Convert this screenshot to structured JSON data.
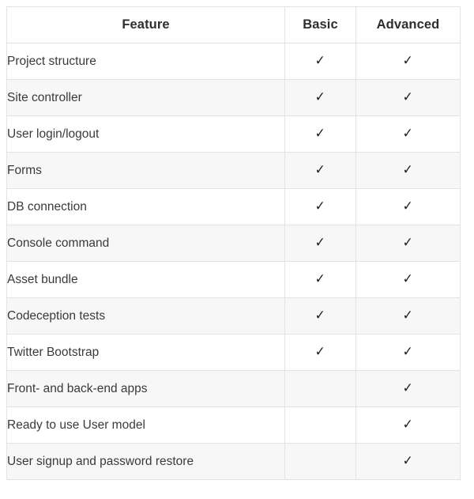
{
  "table": {
    "columns": [
      {
        "key": "feature",
        "label": "Feature",
        "align": "left"
      },
      {
        "key": "basic",
        "label": "Basic",
        "align": "center"
      },
      {
        "key": "advanced",
        "label": "Advanced",
        "align": "center"
      }
    ],
    "check_mark": "✓",
    "colors": {
      "row_odd_background": "#ffffff",
      "row_even_background": "#f7f7f7",
      "border": "#e3e3e3",
      "header_text": "#2e2e2e",
      "body_text": "#3a3a3a",
      "check_mark_color": "#1b1b1b"
    },
    "rows": [
      {
        "feature": "Project structure",
        "basic": "✓",
        "advanced": "✓"
      },
      {
        "feature": "Site controller",
        "basic": "✓",
        "advanced": "✓"
      },
      {
        "feature": "User login/logout",
        "basic": "✓",
        "advanced": "✓"
      },
      {
        "feature": "Forms",
        "basic": "✓",
        "advanced": "✓"
      },
      {
        "feature": "DB connection",
        "basic": "✓",
        "advanced": "✓"
      },
      {
        "feature": "Console command",
        "basic": "✓",
        "advanced": "✓"
      },
      {
        "feature": "Asset bundle",
        "basic": "✓",
        "advanced": "✓"
      },
      {
        "feature": "Codeception tests",
        "basic": "✓",
        "advanced": "✓"
      },
      {
        "feature": "Twitter Bootstrap",
        "basic": "✓",
        "advanced": "✓"
      },
      {
        "feature": "Front- and back-end apps",
        "basic": "",
        "advanced": "✓"
      },
      {
        "feature": "Ready to use User model",
        "basic": "",
        "advanced": "✓"
      },
      {
        "feature": "User signup and password restore",
        "basic": "",
        "advanced": "✓"
      }
    ]
  }
}
